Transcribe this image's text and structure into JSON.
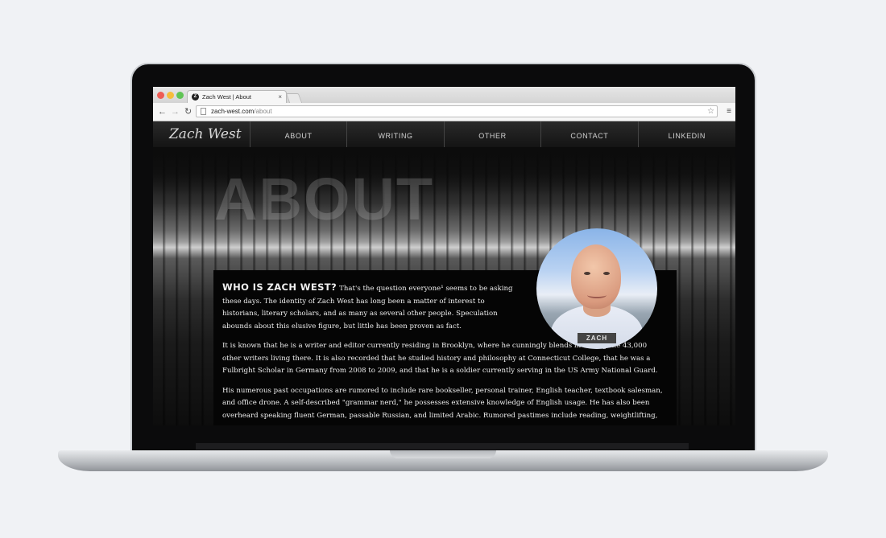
{
  "browser": {
    "tab_title": "Zach West | About",
    "tab_favicon": "Z",
    "tab_close": "×",
    "url_host": "zach-west.com",
    "url_path": "/about",
    "icons": [
      "back-arrow-icon",
      "forward-arrow-icon",
      "reload-icon",
      "page-icon",
      "star-icon",
      "menu-icon"
    ]
  },
  "site": {
    "logo": "Zach West",
    "nav": [
      "ABOUT",
      "WRITING",
      "OTHER",
      "CONTACT",
      "LINKEDIN"
    ],
    "hero_heading": "ABOUT",
    "profile_label": "ZACH",
    "lead": "WHO IS ZACH WEST?",
    "paragraph1": "That's the question everyone¹ seems to be asking these days. The identity of Zach West has long been a matter of interest to historians, literary scholars, and as many as several other people. Speculation abounds about this elusive figure, but little has been proven as fact.",
    "paragraph2": "It is known that he is a writer and editor currently residing in Brooklyn, where he cunningly blends in among the 43,000 other writers living there. It is also recorded that he studied history and philosophy at Connecticut College, that he was a Fulbright Scholar in Germany from 2008 to 2009, and that he is a soldier currently serving in the US Army National Guard.",
    "paragraph3": "His numerous past occupations are rumored to include rare bookseller, personal trainer, English teacher, textbook salesman, and office drone. A self-described \"grammar nerd,\" he possesses extensive knowledge of English usage. He has also been overheard speaking fluent German, passable Russian, and limited Arabic. Rumored pastimes include reading, weightlifting,"
  }
}
